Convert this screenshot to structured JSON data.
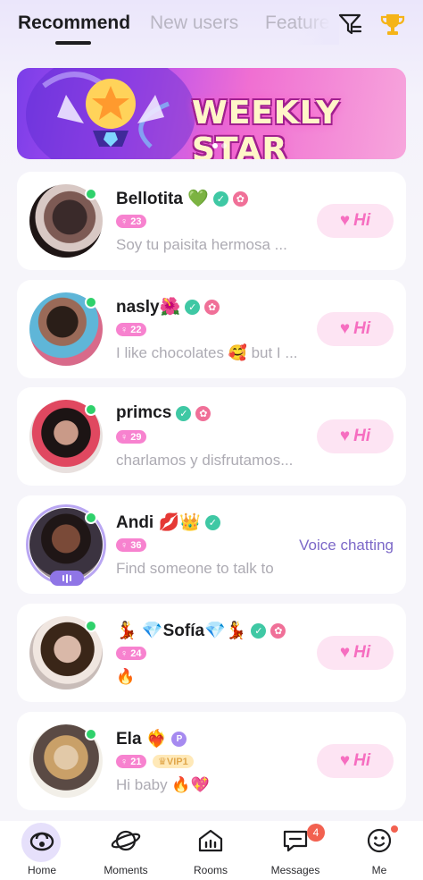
{
  "tabs": [
    {
      "label": "Recommend",
      "active": true
    },
    {
      "label": "New users",
      "active": false
    },
    {
      "label": "Feature",
      "active": false
    }
  ],
  "top_icons": [
    "filter-icon",
    "trophy-icon"
  ],
  "banner": {
    "text": "WEEKLY STAR"
  },
  "users": [
    {
      "name": "Bellotita 💚",
      "age": "23",
      "status": "Soy tu paisita hermosa ...",
      "action": "Hi",
      "verified": true,
      "flower": true
    },
    {
      "name": "nasly🌺",
      "age": "22",
      "status": "I like chocolates 🥰 but I ...",
      "action": "Hi",
      "verified": true,
      "flower": true
    },
    {
      "name": "primcs",
      "age": "29",
      "status": "charlamos y disfrutamos...",
      "action": "Hi",
      "verified": true,
      "flower": true
    },
    {
      "name": "Andi 💋👑",
      "age": "36",
      "status": "Find someone to talk to",
      "action": "Voice chatting",
      "verified": true,
      "flower": false
    },
    {
      "name": "💃 💎Sofía💎💃",
      "age": "24",
      "status": "🔥",
      "action": "Hi",
      "verified": true,
      "flower": true
    },
    {
      "name": "Ela ❤️‍🔥",
      "age": "21",
      "vip": "VIP1",
      "status": "Hi baby 🔥💖",
      "action": "Hi",
      "verified": false,
      "flower": false
    }
  ],
  "nav": [
    {
      "label": "Home",
      "icon": "home-icon",
      "active": true
    },
    {
      "label": "Moments",
      "icon": "planet-icon"
    },
    {
      "label": "Rooms",
      "icon": "rooms-icon"
    },
    {
      "label": "Messages",
      "icon": "message-icon",
      "badge": "4"
    },
    {
      "label": "Me",
      "icon": "smile-icon",
      "dot": true
    }
  ],
  "colors": {
    "accent": "#f66ec0",
    "online": "#2fd16b",
    "voice": "#7c68c8",
    "badge": "#f26150"
  }
}
